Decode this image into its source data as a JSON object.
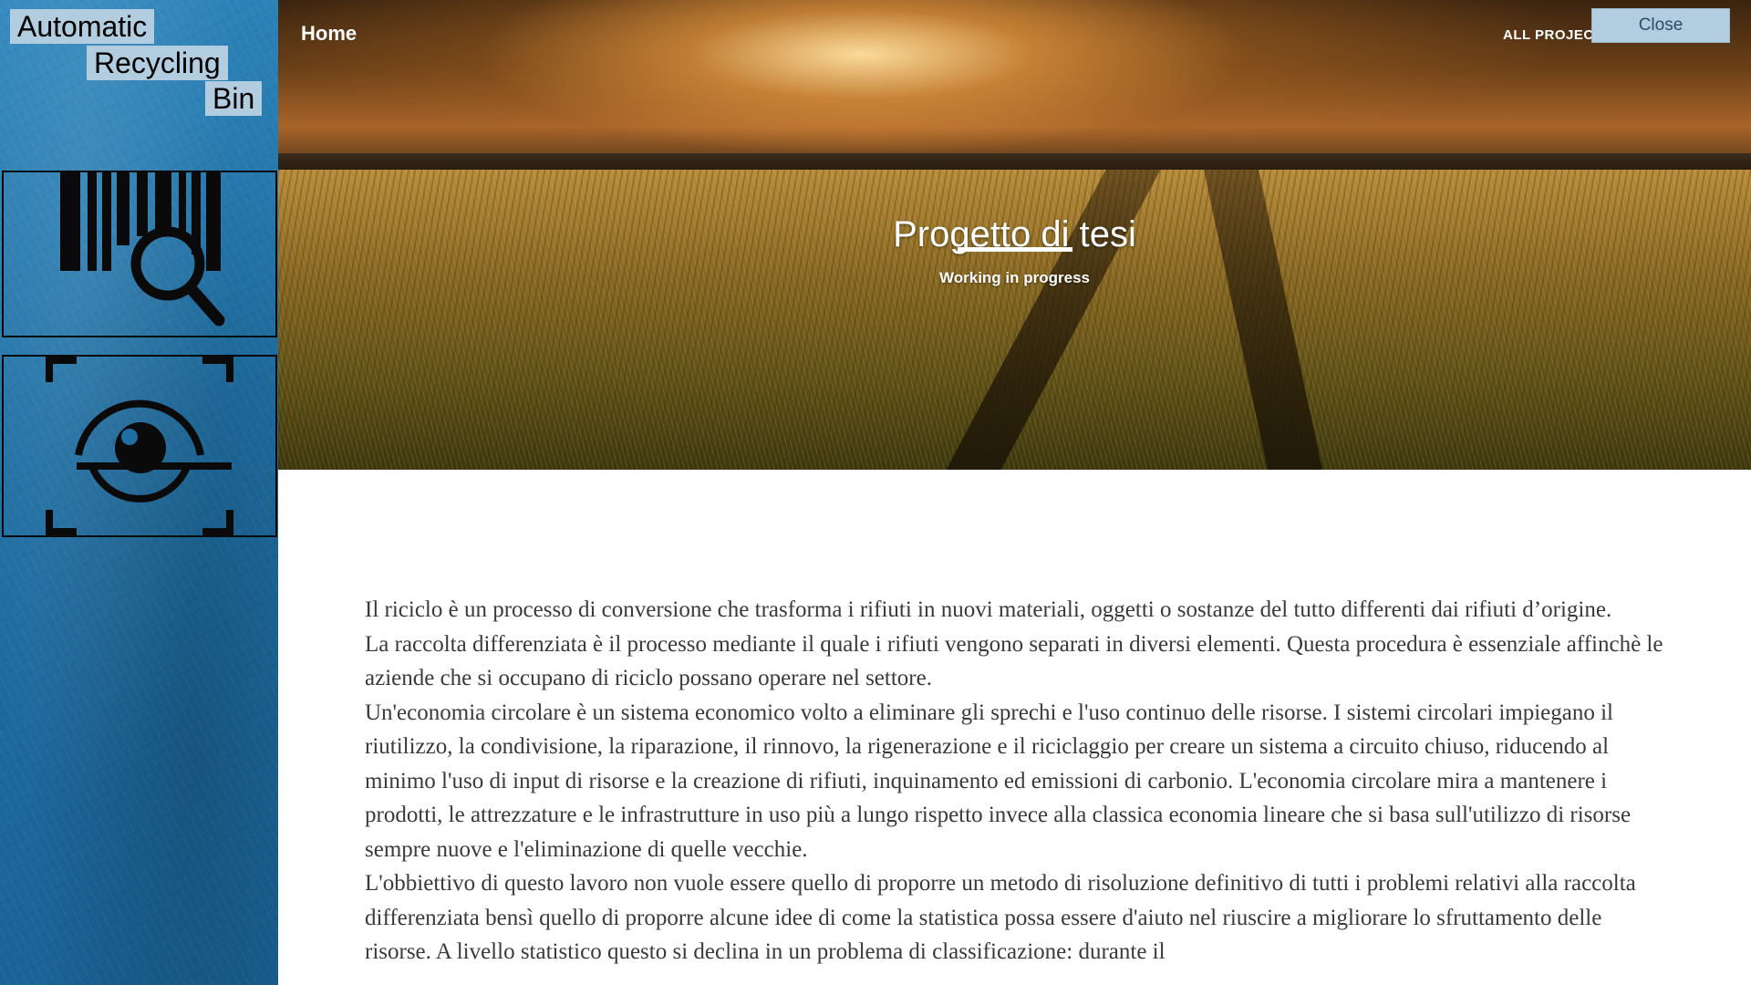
{
  "sidebar": {
    "title_words": [
      "Automatic",
      "Recycling",
      "Bin"
    ],
    "tools": [
      {
        "icon": "barcode-search-icon"
      },
      {
        "icon": "camera-eye-scan-icon"
      }
    ]
  },
  "header": {
    "home_label": "Home",
    "projects_label": "ALL PROJEC",
    "close_label": "Close"
  },
  "hero": {
    "title": "Progetto di tesi",
    "subtitle": "Working in progress"
  },
  "content": {
    "paragraphs": [
      "Il riciclo è un processo di conversione che trasforma i rifiuti in nuovi materiali, oggetti o sostanze del tutto differenti dai rifiuti d’origine.",
      "La raccolta differenziata è il processo mediante il quale i rifiuti vengono separati in diversi elementi. Questa procedura è essenziale affinchè le aziende che si occupano di riciclo possano operare nel settore.",
      "Un'economia circolare è un sistema economico volto a eliminare gli sprechi e l'uso continuo delle risorse. I sistemi circolari impiegano il riutilizzo, la condivisione, la riparazione, il rinnovo, la rigenerazione e il riciclaggio per creare un sistema a circuito chiuso, riducendo al minimo l'uso di input di risorse e la creazione di rifiuti, inquinamento ed emissioni di carbonio. L'economia circolare mira a mantenere i prodotti, le attrezzature e le infrastrutture in uso più a lungo rispetto invece alla classica economia lineare che si basa sull'utilizzo di risorse sempre nuove e l'eliminazione di quelle vecchie.",
      "L'obbiettivo di questo lavoro non vuole essere quello di proporre un metodo di risoluzione definitivo di tutti i problemi relativi alla raccolta differenziata bensì quello di proporre alcune idee di come la statistica possa essere d'aiuto nel riuscire a migliorare lo sfruttamento delle risorse. A livello statistico questo si declina in un problema di classificazione: durante il"
    ]
  }
}
